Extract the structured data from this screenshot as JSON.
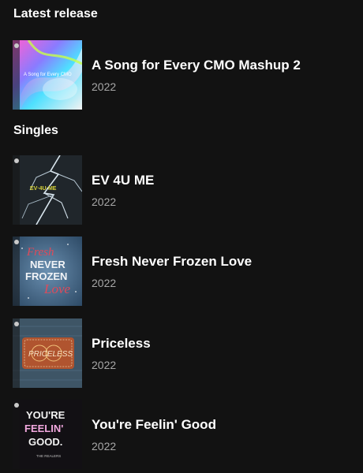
{
  "sections": {
    "latest_title": "Latest release",
    "singles_title": "Singles"
  },
  "latest": {
    "title": "A Song for Every CMO Mashup 2",
    "year": "2022",
    "cover_text": "A Song for Every CMO"
  },
  "singles": [
    {
      "title": "EV 4U ME",
      "year": "2022",
      "cover_text": "EV·4U·ME"
    },
    {
      "title": "Fresh Never Frozen Love",
      "year": "2022",
      "cover_text_1": "Fresh",
      "cover_text_2": "NEVER",
      "cover_text_3": "FROZEN",
      "cover_text_4": "Love"
    },
    {
      "title": "Priceless",
      "year": "2022",
      "cover_text": "PRICELESS"
    },
    {
      "title": "You're Feelin' Good",
      "year": "2022",
      "cover_text_1": "YOU'RE",
      "cover_text_2": "FEELIN'",
      "cover_text_3": "GOOD.",
      "cover_text_4": "THE REALERS"
    }
  ]
}
